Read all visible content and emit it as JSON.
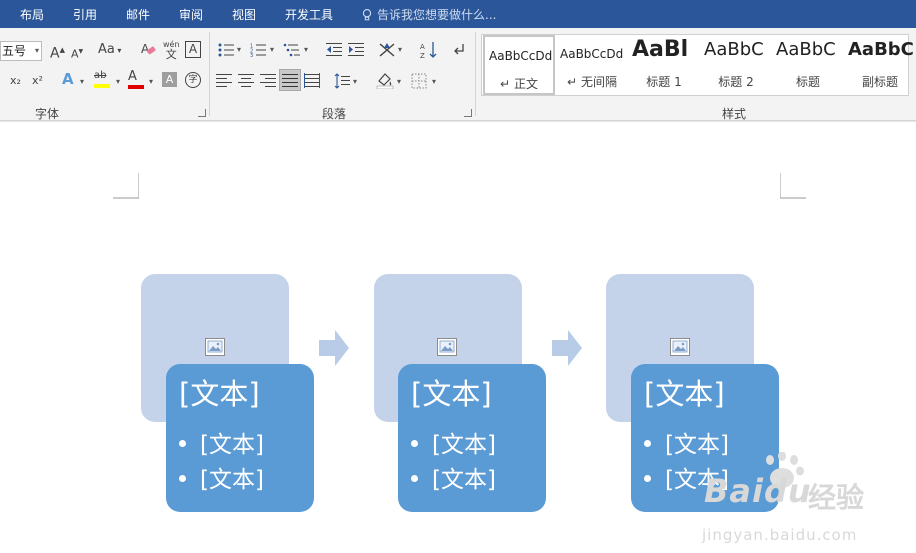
{
  "menu_tabs": [
    "布局",
    "引用",
    "邮件",
    "审阅",
    "视图",
    "开发工具"
  ],
  "tell_me": "告诉我您想要做什么...",
  "font": {
    "size_value": "五号",
    "group_label": "字体",
    "grow_glyph": "A",
    "shrink_glyph": "A",
    "case_glyph": "Aa",
    "phonetic_top": "wén",
    "phonetic_bottom": "文",
    "border_glyph": "A",
    "sub_glyph": "x₂",
    "sup_glyph": "x²",
    "effect_glyph": "A",
    "highlight_glyph": "ab",
    "color_glyph": "A",
    "shade_glyph": "A",
    "enclose_glyph": "字"
  },
  "paragraph": {
    "group_label": "段落"
  },
  "styles": {
    "group_label": "样式",
    "items": [
      {
        "sample": "AaBbCcDd",
        "name": "正文",
        "mark": "↵"
      },
      {
        "sample": "AaBbCcDd",
        "name": "无间隔",
        "mark": "↵"
      },
      {
        "sample": "AaBl",
        "name": "标题 1",
        "mark": ""
      },
      {
        "sample": "AaBbC",
        "name": "标题 2",
        "mark": ""
      },
      {
        "sample": "AaBbC",
        "name": "标题",
        "mark": ""
      },
      {
        "sample": "AaBbC",
        "name": "副标题",
        "mark": ""
      }
    ]
  },
  "smartart": {
    "blocks": [
      {
        "title": "[文本]",
        "bullets": [
          "[文本]",
          "[文本]"
        ]
      },
      {
        "title": "[文本]",
        "bullets": [
          "[文本]",
          "[文本]"
        ]
      },
      {
        "title": "[文本]",
        "bullets": [
          "[文本]",
          "[文本]"
        ]
      }
    ]
  },
  "watermark": {
    "brand": "Baidu",
    "cn": "经验",
    "url": "jingyan.baidu.com"
  },
  "colors": {
    "ribbon_blue": "#2b579a",
    "shape_light": "#c5d3ea",
    "shape_dark": "#5b9bd5",
    "highlight_yellow": "#ffff00",
    "font_red": "#e00000"
  }
}
